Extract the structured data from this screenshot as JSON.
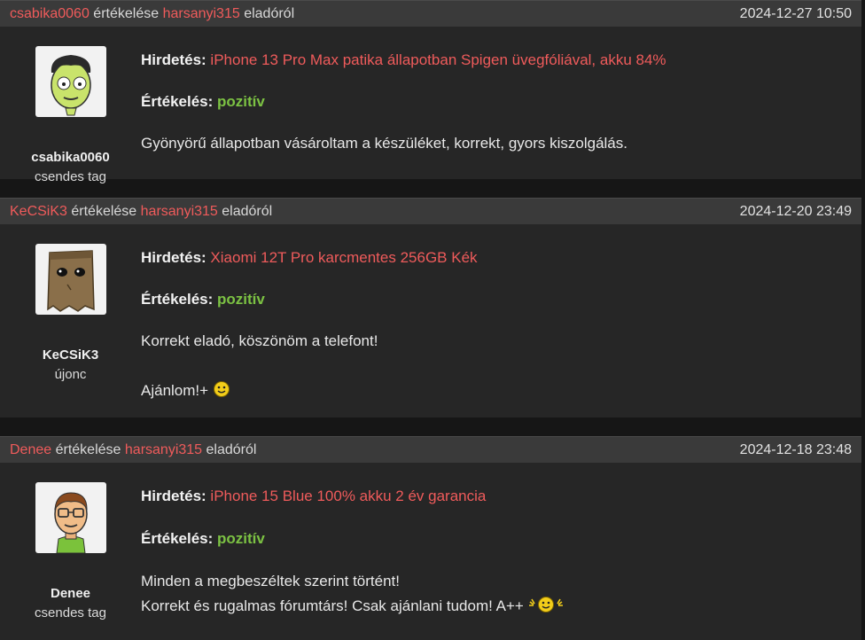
{
  "colors": {
    "link": "#ef5b5b",
    "positive": "#7cc243",
    "header_bg": "#3a3a3a",
    "body_bg": "#262626"
  },
  "reviews": [
    {
      "reviewer": "csabika0060",
      "verb": "értékelése",
      "seller": "harsanyi315",
      "suffix": "eladóról",
      "date": "2024-12-27 10:50",
      "rank": "csendes tag",
      "ad_label": "Hirdetés:",
      "ad_title": "iPhone 13 Pro Max patika állapotban Spigen üvegfóliával, akku 84%",
      "rating_label": "Értékelés:",
      "rating": "pozitív",
      "text": [
        "Gyönyörű állapotban vásároltam a készüléket, korrekt, gyors kiszolgálás."
      ],
      "avatar_icon": "green-face-avatar-icon"
    },
    {
      "reviewer": "KeCSiK3",
      "verb": "értékelése",
      "seller": "harsanyi315",
      "suffix": "eladóról",
      "date": "2024-12-20 23:49",
      "rank": "újonc",
      "ad_label": "Hirdetés:",
      "ad_title": "Xiaomi 12T Pro karcmentes 256GB Kék",
      "rating_label": "Értékelés:",
      "rating": "pozitív",
      "text": [
        "Korrekt eladó, köszönöm a telefont!",
        "Ajánlom!+"
      ],
      "avatar_icon": "paper-bag-avatar-icon"
    },
    {
      "reviewer": "Denee",
      "verb": "értékelése",
      "seller": "harsanyi315",
      "suffix": "eladóról",
      "date": "2024-12-18 23:48",
      "rank": "csendes tag",
      "ad_label": "Hirdetés:",
      "ad_title": "iPhone 15 Blue 100% akku 2 év garancia",
      "rating_label": "Értékelés:",
      "rating": "pozitív",
      "text": [
        "Minden a megbeszéltek szerint történt!",
        "Korrekt és rugalmas fórumtárs! Csak ajánlani tudom! A++"
      ],
      "avatar_icon": "glasses-man-avatar-icon"
    }
  ]
}
